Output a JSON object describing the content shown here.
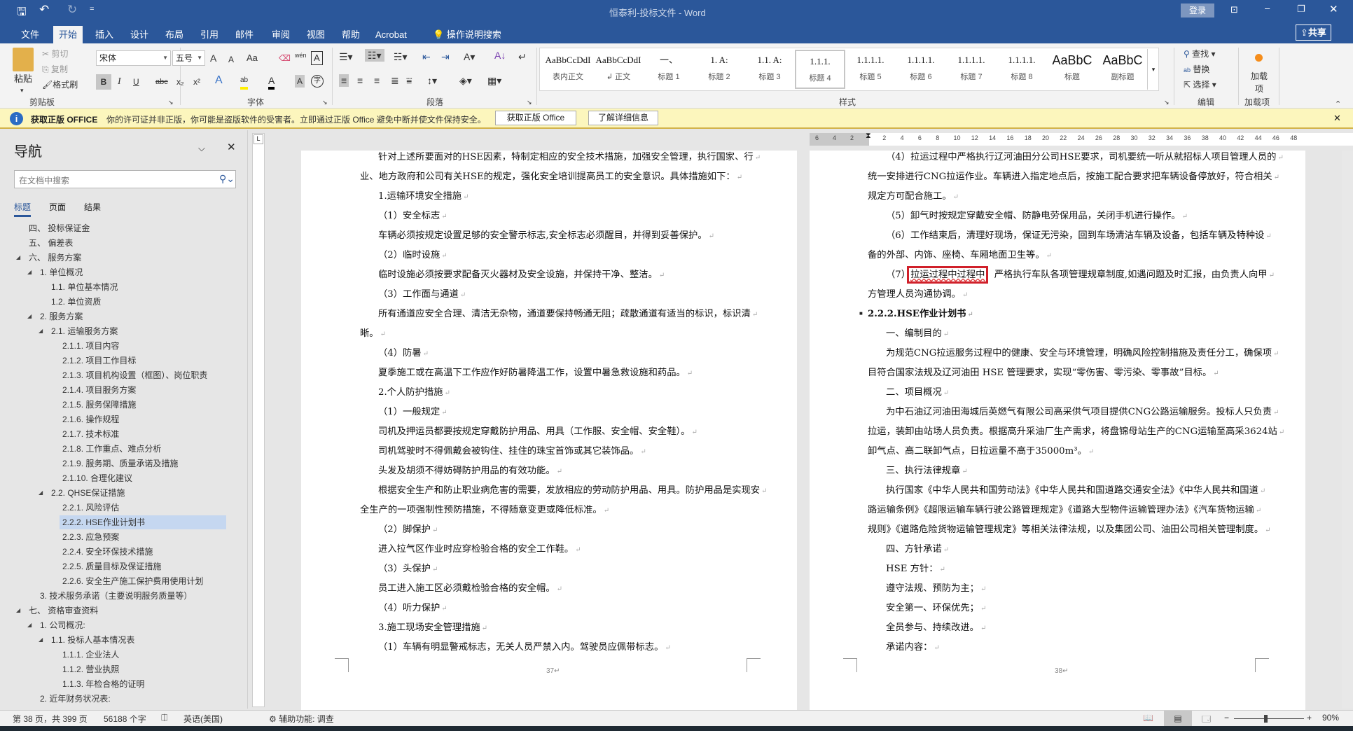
{
  "titlebar": {
    "title": "恒泰利-投标文件  -  Word",
    "login": "登录",
    "qat_more": "="
  },
  "tabs": [
    {
      "label": "文件"
    },
    {
      "label": "开始",
      "active": true
    },
    {
      "label": "插入"
    },
    {
      "label": "设计"
    },
    {
      "label": "布局"
    },
    {
      "label": "引用"
    },
    {
      "label": "邮件"
    },
    {
      "label": "审阅"
    },
    {
      "label": "视图"
    },
    {
      "label": "帮助"
    },
    {
      "label": "Acrobat"
    }
  ],
  "tell_me": "操作说明搜索",
  "share": "共享",
  "clipboard": {
    "paste": "粘贴",
    "cut": "剪切",
    "copy": "复制",
    "format_painter": "格式刷",
    "label": "剪贴板"
  },
  "font": {
    "name": "宋体",
    "size": "五号",
    "label": "字体",
    "grow": "A",
    "shrink": "A",
    "case": "Aa",
    "bold": "B",
    "italic": "I",
    "underline": "U",
    "strike": "abc",
    "sub": "x₂",
    "sup": "x²",
    "wen": "wén",
    "charbox": "A",
    "highlight": "ab",
    "color": "A",
    "shade": "A",
    "circle": "字"
  },
  "paragraph": {
    "label": "段落"
  },
  "styles": {
    "label": "样式",
    "items": [
      {
        "preview": "AaBbCcDdI",
        "name": "表内正文"
      },
      {
        "preview": "AaBbCcDdI",
        "name": "↲ 正文"
      },
      {
        "preview": "一、",
        "name": "标题 1"
      },
      {
        "preview": "1.  A:",
        "name": "标题 2"
      },
      {
        "preview": "1.1.  A:",
        "name": "标题 3"
      },
      {
        "preview": "1.1.1.",
        "name": "标题 4",
        "selected": true
      },
      {
        "preview": "1.1.1.1.",
        "name": "标题 5"
      },
      {
        "preview": "1.1.1.1.",
        "name": "标题 6"
      },
      {
        "preview": "1.1.1.1.",
        "name": "标题 7"
      },
      {
        "preview": "1.1.1.1.",
        "name": "标题 8"
      },
      {
        "preview": "AaBbC",
        "name": "标题"
      },
      {
        "preview": "AaBbC",
        "name": "副标题"
      }
    ]
  },
  "editing": {
    "find": "查找",
    "replace": "替换",
    "select": "选择",
    "label": "编辑"
  },
  "addins": {
    "button": "加载项",
    "label": "加载项"
  },
  "infobar": {
    "title": "获取正版 OFFICE",
    "message": "你的许可证并非正版，你可能是盗版软件的受害者。立即通过正版 Office 避免中断并使文件保持安全。",
    "btn_get": "获取正版 Office",
    "btn_learn": "了解详细信息"
  },
  "nav": {
    "title": "导航",
    "search_placeholder": "在文档中搜索",
    "tabs": [
      "标题",
      "页面",
      "结果"
    ],
    "items": [
      {
        "t": "四、 投标保证金",
        "l": 0
      },
      {
        "t": "五、 偏差表",
        "l": 0
      },
      {
        "t": "六、 服务方案",
        "l": 0,
        "e": true
      },
      {
        "t": "1. 单位概况",
        "l": 1,
        "e": true
      },
      {
        "t": "1.1. 单位基本情况",
        "l": 2
      },
      {
        "t": "1.2. 单位资质",
        "l": 2
      },
      {
        "t": "2. 服务方案",
        "l": 1,
        "e": true
      },
      {
        "t": "2.1. 运输服务方案",
        "l": 2,
        "e": true
      },
      {
        "t": "2.1.1. 项目内容",
        "l": 3
      },
      {
        "t": "2.1.2. 项目工作目标",
        "l": 3
      },
      {
        "t": "2.1.3. 项目机构设置（框图）、岗位职责",
        "l": 3
      },
      {
        "t": "2.1.4. 项目服务方案",
        "l": 3
      },
      {
        "t": "2.1.5. 服务保障措施",
        "l": 3
      },
      {
        "t": "2.1.6. 操作规程",
        "l": 3
      },
      {
        "t": "2.1.7. 技术标准",
        "l": 3
      },
      {
        "t": "2.1.8. 工作重点、难点分析",
        "l": 3
      },
      {
        "t": "2.1.9. 服务期、质量承诺及措施",
        "l": 3
      },
      {
        "t": "2.1.10. 合理化建议",
        "l": 3
      },
      {
        "t": "2.2. QHSE保证措施",
        "l": 2,
        "e": true
      },
      {
        "t": "2.2.1. 风险评估",
        "l": 3
      },
      {
        "t": "2.2.2. HSE作业计划书",
        "l": 3,
        "sel": true
      },
      {
        "t": "2.2.3. 应急预案",
        "l": 3
      },
      {
        "t": "2.2.4. 安全环保技术措施",
        "l": 3
      },
      {
        "t": "2.2.5. 质量目标及保证措施",
        "l": 3
      },
      {
        "t": "2.2.6. 安全生产施工保护费用使用计划",
        "l": 3
      },
      {
        "t": "3. 技术服务承诺（主要说明服务质量等）",
        "l": 1
      },
      {
        "t": "七、 资格审查资料",
        "l": 0,
        "e": true
      },
      {
        "t": "1. 公司概况:",
        "l": 1,
        "e": true
      },
      {
        "t": "1.1. 投标人基本情况表",
        "l": 2,
        "e": true
      },
      {
        "t": "1.1.1. 企业法人",
        "l": 3
      },
      {
        "t": "1.1.2. 营业执照",
        "l": 3
      },
      {
        "t": "1.1.3. 年检合格的证明",
        "l": 3
      },
      {
        "t": "2. 近年财务状况表:",
        "l": 1
      }
    ]
  },
  "ruler": {
    "ticks": [
      "6",
      "4",
      "2",
      "2",
      "4",
      "6",
      "8",
      "10",
      "12",
      "14",
      "16",
      "18",
      "20",
      "22",
      "24",
      "26",
      "28",
      "30",
      "32",
      "34",
      "36",
      "38",
      "40",
      "42",
      "44",
      "46",
      "48"
    ]
  },
  "pages": [
    {
      "number": "37↵",
      "lines": [
        {
          "t": "针对上述所要面对的HSE因素，特制定相应的安全技术措施，加强安全管理，执行国家、行",
          "i": 1
        },
        {
          "t": "业、地方政府和公司有关HSE的规定，强化安全培训提高员工的安全意识。具体措施如下："
        },
        {
          "t": "1.运输环境安全措施",
          "i": 1
        },
        {
          "t": "（1）安全标志",
          "i": 1
        },
        {
          "t": "车辆必须按规定设置足够的安全警示标志,安全标志必须醒目，并得到妥善保护。",
          "i": 1
        },
        {
          "t": "（2）临时设施",
          "i": 1
        },
        {
          "t": "临时设施必须按要求配备灭火器材及安全设施，并保持干净、整洁。",
          "i": 1
        },
        {
          "t": "（3）工作面与通道",
          "i": 1
        },
        {
          "t": "所有通道应安全合理、清洁无杂物，通道要保持畅通无阻；疏散通道有适当的标识，标识清",
          "i": 1
        },
        {
          "t": "晰。"
        },
        {
          "t": "（4）防暑",
          "i": 1
        },
        {
          "t": "夏季施工或在高温下工作应作好防暑降温工作，设置中暑急救设施和药品。",
          "i": 1
        },
        {
          "t": "2.个人防护措施",
          "i": 1
        },
        {
          "t": "（1）一般规定",
          "i": 1
        },
        {
          "t": "司机及押运员都要按规定穿戴防护用品、用具（工作服、安全帽、安全鞋）。",
          "i": 1
        },
        {
          "t": "司机驾驶时不得佩戴会被钩住、挂住的珠宝首饰或其它装饰品。",
          "i": 1
        },
        {
          "t": "头发及胡须不得妨碍防护用品的有效功能。",
          "i": 1
        },
        {
          "t": "根据安全生产和防止职业病危害的需要，发放相应的劳动防护用品、用具。防护用品是实现安",
          "i": 1
        },
        {
          "t": "全生产的一项强制性预防措施，不得随意变更或降低标准。"
        },
        {
          "t": "（2）脚保护",
          "i": 1
        },
        {
          "t": "进入拉气区作业时应穿检验合格的安全工作鞋。",
          "i": 1
        },
        {
          "t": "（3）头保护",
          "i": 1
        },
        {
          "t": "员工进入施工区必须戴检验合格的安全帽。",
          "i": 1
        },
        {
          "t": "（4）听力保护",
          "i": 1
        },
        {
          "t": "3.施工现场安全管理措施",
          "i": 1
        },
        {
          "t": "（1）车辆有明显警戒标志，无关人员严禁入内。驾驶员应佩带标志。",
          "i": 1
        }
      ]
    },
    {
      "number": "38↵",
      "lines": [
        {
          "t": "（4）拉运过程中严格执行辽河油田分公司HSE要求，司机要统一听从就招标人项目管理人员的",
          "i": 1
        },
        {
          "t": "统一安排进行CNG拉运作业。车辆进入指定地点后，按施工配合要求把车辆设备停放好，符合相关"
        },
        {
          "t": "规定方可配合施工。"
        },
        {
          "t": "（5）卸气时按规定穿戴安全帽、防静电劳保用品，关闭手机进行操作。",
          "i": 1
        },
        {
          "t": "（6）工作结束后，清理好现场，保证无污染，回到车场清洁车辆及设备，包括车辆及特种设",
          "i": 1
        },
        {
          "t": "备的外部、内饰、座椅、车厢地面卫生等。"
        },
        {
          "t": "（7）",
          "m": "拉运过程中过程中",
          "p": "，严格执行车队各项管理规章制度,如遇问题及时汇报，由负责人向甲",
          "i": 1
        },
        {
          "t": "方管理人员沟通协调。"
        },
        {
          "t": "2.2.2.HSE作业计划书",
          "h": 1
        },
        {
          "t": "一、编制目的",
          "i": 1
        },
        {
          "t": "为规范CNG拉运服务过程中的健康、安全与环境管理，明确风险控制措施及责任分工，确保项",
          "i": 1
        },
        {
          "t": "目符合国家法规及辽河油田 HSE 管理要求，实现“零伤害、零污染、零事故”目标。"
        },
        {
          "t": "二、项目概况",
          "i": 1
        },
        {
          "t": "为中石油辽河油田海城后英燃气有限公司高采供气项目提供CNG公路运输服务。投标人只负责",
          "i": 1
        },
        {
          "t": "拉运，装卸由站场人员负责。根据高升采油厂生产需求，将盘锦母站生产的CNG运输至高采3624站"
        },
        {
          "t": "卸气点、高二联卸气点，日拉运量不高于35000m³。"
        },
        {
          "t": "三、执行法律规章",
          "i": 1
        },
        {
          "t": "执行国家《中华人民共和国劳动法》《中华人民共和国道路交通安全法》《中华人民共和国道",
          "i": 1
        },
        {
          "t": "路运输条例》《超限运输车辆行驶公路管理规定》《道路大型物件运输管理办法》《汽车货物运输"
        },
        {
          "t": "规则》《道路危险货物运输管理规定》等相关法律法规，以及集团公司、油田公司相关管理制度。"
        },
        {
          "t": "四、方针承诺",
          "i": 1
        },
        {
          "t": "HSE 方针：",
          "i": 1
        },
        {
          "t": "遵守法规、预防为主；",
          "i": 1
        },
        {
          "t": "安全第一、环保优先；",
          "i": 1
        },
        {
          "t": "全员参与、持续改进。",
          "i": 1
        },
        {
          "t": "承诺内容：",
          "i": 1
        }
      ]
    }
  ],
  "statusbar": {
    "page": "第 38 页，共 399 页",
    "words": "56188 个字",
    "language": "英语(美国)",
    "accessibility": "辅助功能: 调查",
    "zoom": "90%",
    "zoom_value": 90
  },
  "colors": {
    "brand": "#2b579a",
    "infobar": "#fcf6bd",
    "highlight_box": "#d0202a"
  }
}
